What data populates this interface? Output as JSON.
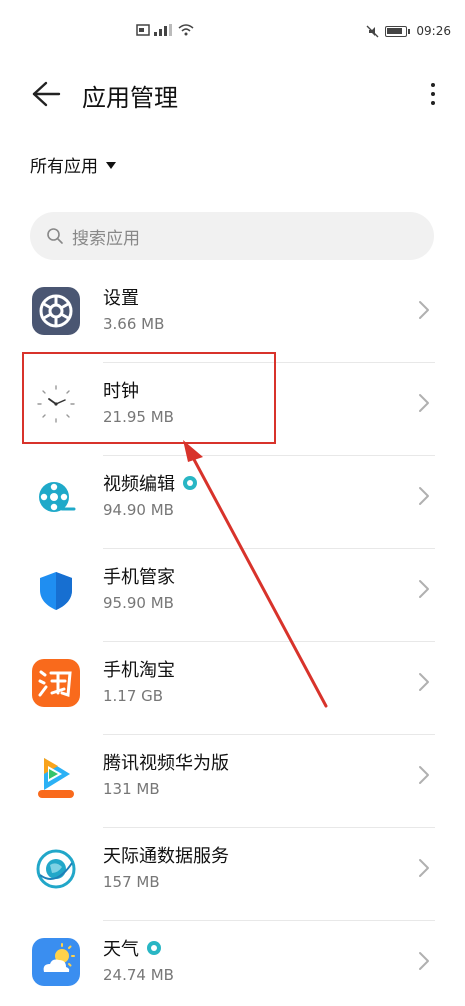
{
  "status_bar": {
    "time": "09:26"
  },
  "header": {
    "title": "应用管理"
  },
  "filter": {
    "label": "所有应用"
  },
  "search": {
    "placeholder": "搜索应用"
  },
  "apps": [
    {
      "name": "设置",
      "size": "3.66 MB",
      "icon": "settings-icon",
      "badge": false
    },
    {
      "name": "时钟",
      "size": "21.95 MB",
      "icon": "clock-icon",
      "badge": false
    },
    {
      "name": "视频编辑",
      "size": "94.90 MB",
      "icon": "video-edit-icon",
      "badge": true
    },
    {
      "name": "手机管家",
      "size": "95.90 MB",
      "icon": "phone-manager-icon",
      "badge": false
    },
    {
      "name": "手机淘宝",
      "size": "1.17 GB",
      "icon": "taobao-icon",
      "badge": false
    },
    {
      "name": "腾讯视频华为版",
      "size": "131 MB",
      "icon": "tencent-video-icon",
      "badge": false
    },
    {
      "name": "天际通数据服务",
      "size": "157 MB",
      "icon": "skytone-icon",
      "badge": false
    },
    {
      "name": "天气",
      "size": "24.74 MB",
      "icon": "weather-icon",
      "badge": true
    }
  ],
  "annotation": {
    "highlight_color": "#d8332b"
  }
}
